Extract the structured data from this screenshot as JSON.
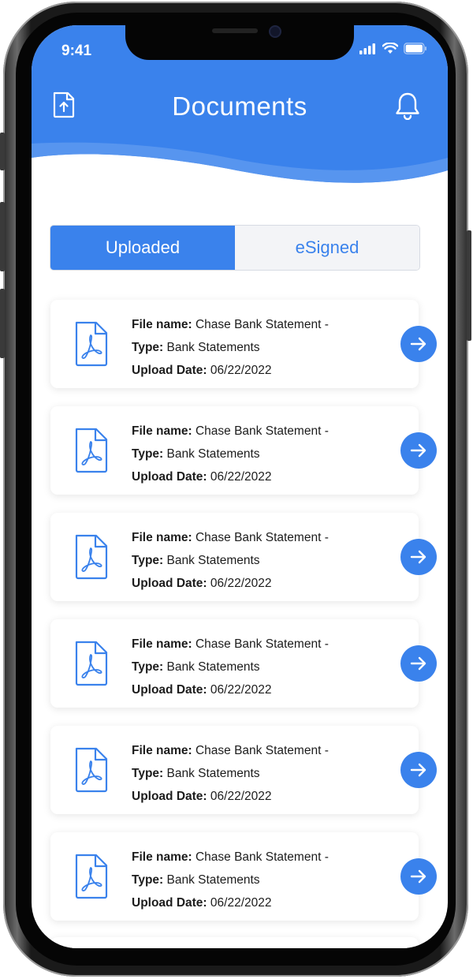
{
  "status_bar": {
    "time": "9:41"
  },
  "header": {
    "title": "Documents",
    "upload_icon": "upload-file-icon",
    "bell_icon": "bell-icon"
  },
  "tabs": [
    {
      "label": "Uploaded",
      "active": true
    },
    {
      "label": "eSigned",
      "active": false
    }
  ],
  "documents": [
    {
      "file_label": "File name:",
      "file_name": "Chase Bank Statement -",
      "type_label": "Type:",
      "type": "Bank Statements",
      "date_label": "Upload Date:",
      "date": "06/22/2022"
    },
    {
      "file_label": "File name:",
      "file_name": "Chase Bank Statement -",
      "type_label": "Type:",
      "type": "Bank Statements",
      "date_label": "Upload Date:",
      "date": "06/22/2022"
    },
    {
      "file_label": "File name:",
      "file_name": "Chase Bank Statement -",
      "type_label": "Type:",
      "type": "Bank Statements",
      "date_label": "Upload Date:",
      "date": "06/22/2022"
    },
    {
      "file_label": "File name:",
      "file_name": "Chase Bank Statement -",
      "type_label": "Type:",
      "type": "Bank Statements",
      "date_label": "Upload Date:",
      "date": "06/22/2022"
    },
    {
      "file_label": "File name:",
      "file_name": "Chase Bank Statement -",
      "type_label": "Type:",
      "type": "Bank Statements",
      "date_label": "Upload Date:",
      "date": "06/22/2022"
    },
    {
      "file_label": "File name:",
      "file_name": "Chase Bank Statement -",
      "type_label": "Type:",
      "type": "Bank Statements",
      "date_label": "Upload Date:",
      "date": "06/22/2022"
    }
  ],
  "colors": {
    "accent": "#3a82ec",
    "header_bg": "#3a82ec",
    "card_bg": "#ffffff"
  }
}
